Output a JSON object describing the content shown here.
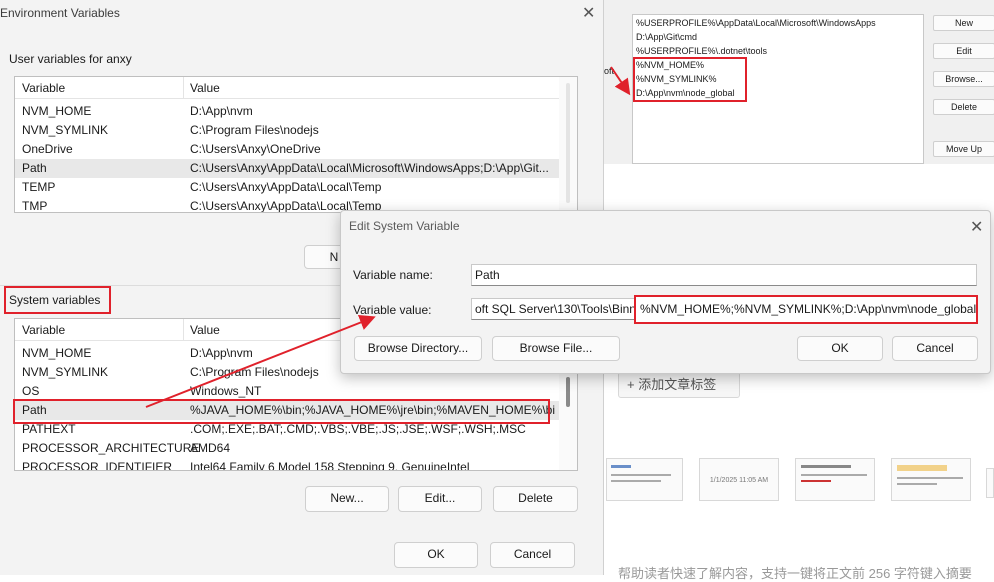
{
  "env_dialog": {
    "title": "Environment Variables",
    "user_section_label": "User variables for anxy",
    "user_columns": [
      "Variable",
      "Value"
    ],
    "user_rows": [
      {
        "variable": "NVM_HOME",
        "value": "D:\\App\\nvm"
      },
      {
        "variable": "NVM_SYMLINK",
        "value": "C:\\Program Files\\nodejs"
      },
      {
        "variable": "OneDrive",
        "value": "C:\\Users\\Anxy\\OneDrive"
      },
      {
        "variable": "Path",
        "value": "C:\\Users\\Anxy\\AppData\\Local\\Microsoft\\WindowsApps;D:\\App\\Git..."
      },
      {
        "variable": "TEMP",
        "value": "C:\\Users\\Anxy\\AppData\\Local\\Temp"
      },
      {
        "variable": "TMP",
        "value": "C:\\Users\\Anxy\\AppData\\Local\\Temp"
      }
    ],
    "user_new_button_partial": "N",
    "system_section_label": "System variables",
    "system_columns": [
      "Variable",
      "Value"
    ],
    "system_rows": [
      {
        "variable": "NVM_HOME",
        "value": "D:\\App\\nvm"
      },
      {
        "variable": "NVM_SYMLINK",
        "value": "C:\\Program Files\\nodejs"
      },
      {
        "variable": "OS",
        "value": "Windows_NT"
      },
      {
        "variable": "Path",
        "value": "%JAVA_HOME%\\bin;%JAVA_HOME%\\jre\\bin;%MAVEN_HOME%\\bi..."
      },
      {
        "variable": "PATHEXT",
        "value": ".COM;.EXE;.BAT;.CMD;.VBS;.VBE;.JS;.JSE;.WSF;.WSH;.MSC"
      },
      {
        "variable": "PROCESSOR_ARCHITECTURE",
        "value": "AMD64"
      },
      {
        "variable": "PROCESSOR_IDENTIFIER",
        "value": "Intel64 Family 6 Model 158 Stepping 9, GenuineIntel"
      }
    ],
    "system_buttons": {
      "new": "New...",
      "edit": "Edit...",
      "delete": "Delete"
    },
    "ok": "OK",
    "cancel": "Cancel"
  },
  "edit_dialog": {
    "title": "Edit System Variable",
    "name_label": "Variable name:",
    "name_value": "Path",
    "value_label": "Variable value:",
    "value_prefix": "oft SQL Server\\130\\Tools\\Binn\\;",
    "value_highlight": "%NVM_HOME%;%NVM_SYMLINK%;D:\\App\\nvm\\node_global;",
    "browse_directory": "Browse Directory...",
    "browse_file": "Browse File...",
    "ok": "OK",
    "cancel": "Cancel"
  },
  "bg_path_editor": {
    "entries": [
      "%USERPROFILE%\\AppData\\Local\\Microsoft\\WindowsApps",
      "D:\\App\\Git\\cmd",
      "%USERPROFILE%\\.dotnet\\tools",
      "%NVM_HOME%",
      "%NVM_SYMLINK%",
      "D:\\App\\nvm\\node_global"
    ],
    "buttons": [
      "New",
      "Edit",
      "Browse...",
      "Delete",
      "Move Up"
    ],
    "cut_text": "oft"
  },
  "bg_page": {
    "add_tag": "添加文章标签",
    "thumb_timestamp": "1/1/2025 11:05 AM",
    "bottom_text": "帮助读者快速了解内容，支持一键将正文前 256 字符键入摘要"
  },
  "colors": {
    "highlight": "#e0212b",
    "dialog_bg": "#f3f3f3"
  }
}
